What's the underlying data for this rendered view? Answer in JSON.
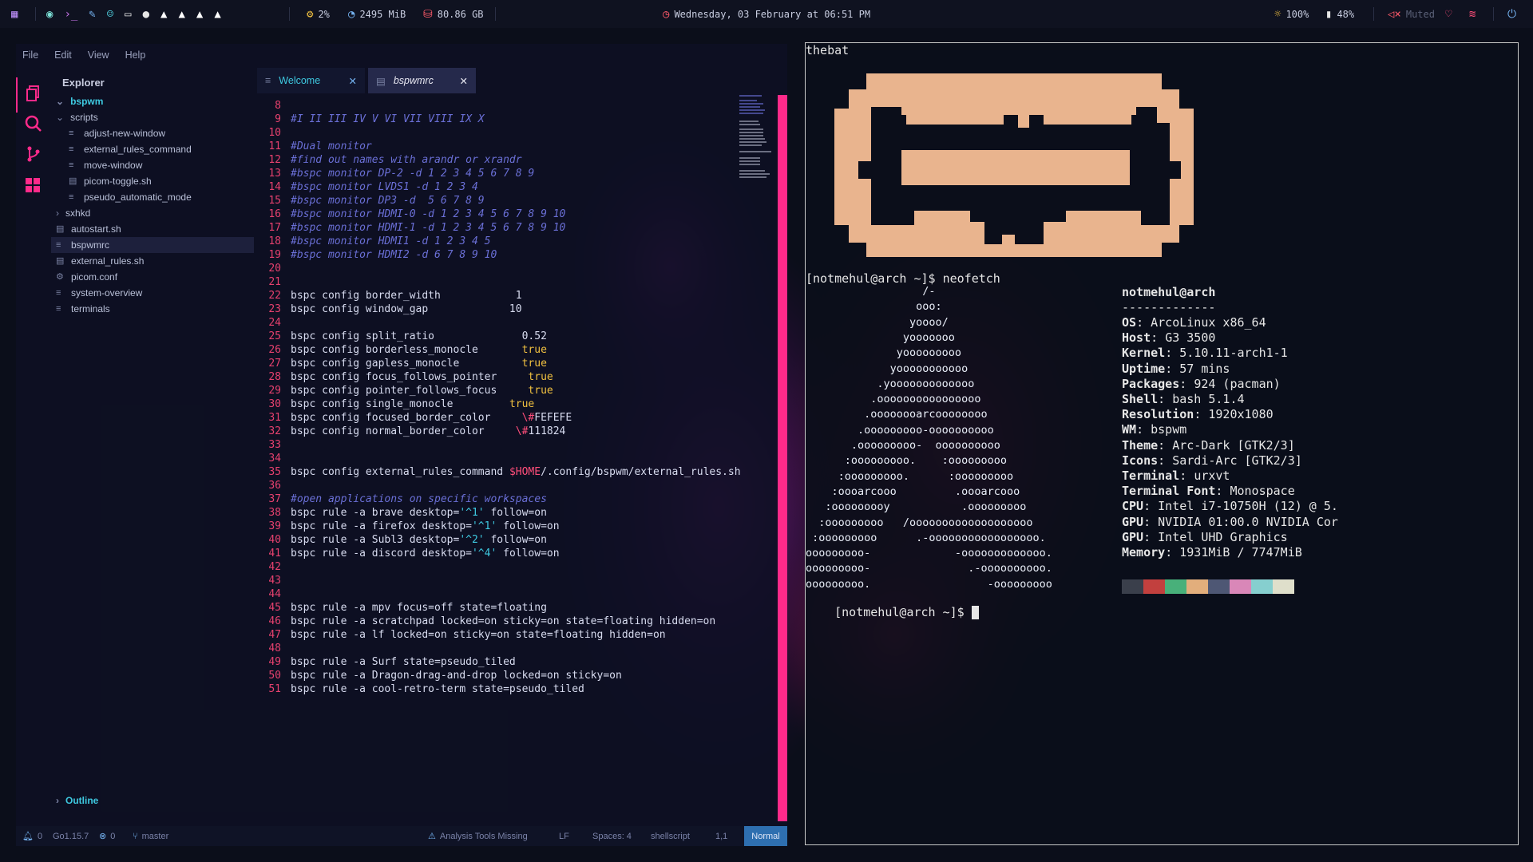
{
  "topbar": {
    "cpu": "2%",
    "memory": "2495 MiB",
    "disk": "80.86 GB",
    "datetime": "Wednesday, 03 February at 06:51 PM",
    "brightness": "100%",
    "battery": "48%",
    "volume": "Muted"
  },
  "editor": {
    "menu": [
      "File",
      "Edit",
      "View",
      "Help"
    ],
    "explorer_title": "Explorer",
    "root_folder": "bspwm",
    "tree": [
      {
        "label": "scripts",
        "type": "folder-open"
      },
      {
        "label": "adjust-new-window",
        "type": "file"
      },
      {
        "label": "external_rules_command",
        "type": "file"
      },
      {
        "label": "move-window",
        "type": "file"
      },
      {
        "label": "picom-toggle.sh",
        "type": "file"
      },
      {
        "label": "pseudo_automatic_mode",
        "type": "file"
      },
      {
        "label": "sxhkd",
        "type": "folder"
      },
      {
        "label": "autostart.sh",
        "type": "file"
      },
      {
        "label": "bspwmrc",
        "type": "file"
      },
      {
        "label": "external_rules.sh",
        "type": "file"
      },
      {
        "label": "picom.conf",
        "type": "settings"
      },
      {
        "label": "system-overview",
        "type": "file"
      },
      {
        "label": "terminals",
        "type": "file"
      }
    ],
    "outline_label": "Outline",
    "tabs": [
      {
        "label": "Welcome",
        "active": false
      },
      {
        "label": "bspwmrc",
        "active": true
      }
    ],
    "code_lines": [
      {
        "n": "8",
        "t": ""
      },
      {
        "n": "9",
        "t": "#I II III IV V VI VII VIII IX X"
      },
      {
        "n": "10",
        "t": ""
      },
      {
        "n": "11",
        "t": "#Dual monitor"
      },
      {
        "n": "12",
        "t": "#find out names with arandr or xrandr"
      },
      {
        "n": "13",
        "t": "#bspc monitor DP-2 -d 1 2 3 4 5 6 7 8 9"
      },
      {
        "n": "14",
        "t": "#bspc monitor LVDS1 -d 1 2 3 4"
      },
      {
        "n": "15",
        "t": "#bspc monitor DP3 -d  5 6 7 8 9"
      },
      {
        "n": "16",
        "t": "#bspc monitor HDMI-0 -d 1 2 3 4 5 6 7 8 9 10"
      },
      {
        "n": "17",
        "t": "#bspc monitor HDMI-1 -d 1 2 3 4 5 6 7 8 9 10"
      },
      {
        "n": "18",
        "t": "#bspc monitor HDMI1 -d 1 2 3 4 5"
      },
      {
        "n": "19",
        "t": "#bspc monitor HDMI2 -d 6 7 8 9 10"
      },
      {
        "n": "20",
        "t": ""
      },
      {
        "n": "21",
        "t": ""
      },
      {
        "n": "22",
        "t": "bspc config border_width            1"
      },
      {
        "n": "23",
        "t": "bspc config window_gap             10"
      },
      {
        "n": "24",
        "t": ""
      },
      {
        "n": "25",
        "t": "bspc config split_ratio              0.52"
      },
      {
        "n": "26",
        "t": "bspc config borderless_monocle       true"
      },
      {
        "n": "27",
        "t": "bspc config gapless_monocle          true"
      },
      {
        "n": "28",
        "t": "bspc config focus_follows_pointer     true"
      },
      {
        "n": "29",
        "t": "bspc config pointer_follows_focus     true"
      },
      {
        "n": "30",
        "t": "bspc config single_monocle         true"
      },
      {
        "n": "31",
        "t": "bspc config focused_border_color     \\#FEFEFE"
      },
      {
        "n": "32",
        "t": "bspc config normal_border_color     \\#111824"
      },
      {
        "n": "33",
        "t": ""
      },
      {
        "n": "34",
        "t": ""
      },
      {
        "n": "35",
        "t": "bspc config external_rules_command $HOME/.config/bspwm/external_rules.sh"
      },
      {
        "n": "36",
        "t": ""
      },
      {
        "n": "37",
        "t": "#open applications on specific workspaces"
      },
      {
        "n": "38",
        "t": "bspc rule -a brave desktop='^1' follow=on"
      },
      {
        "n": "39",
        "t": "bspc rule -a firefox desktop='^1' follow=on"
      },
      {
        "n": "40",
        "t": "bspc rule -a Subl3 desktop='^2' follow=on"
      },
      {
        "n": "41",
        "t": "bspc rule -a discord desktop='^4' follow=on"
      },
      {
        "n": "42",
        "t": ""
      },
      {
        "n": "43",
        "t": ""
      },
      {
        "n": "44",
        "t": ""
      },
      {
        "n": "45",
        "t": "bspc rule -a mpv focus=off state=floating"
      },
      {
        "n": "46",
        "t": "bspc rule -a scratchpad locked=on sticky=on state=floating hidden=on"
      },
      {
        "n": "47",
        "t": "bspc rule -a lf locked=on sticky=on state=floating hidden=on"
      },
      {
        "n": "48",
        "t": ""
      },
      {
        "n": "49",
        "t": "bspc rule -a Surf state=pseudo_tiled"
      },
      {
        "n": "50",
        "t": "bspc rule -a Dragon-drag-and-drop locked=on sticky=on"
      },
      {
        "n": "51",
        "t": "bspc rule -a cool-retro-term state=pseudo_tiled"
      }
    ],
    "status": {
      "notifications": "0",
      "go_version": "Go1.15.7",
      "errors": "0",
      "branch": "master",
      "analysis": "Analysis Tools Missing",
      "eol": "LF",
      "spaces": "Spaces: 4",
      "language": "shellscript",
      "position": "1,1",
      "mode": "Normal"
    }
  },
  "terminal": {
    "title": "thebat",
    "prompt1": "[notmehul@arch ~]$ neofetch",
    "prompt2": "[notmehul@arch ~]$ ",
    "user_host": "notmehul@arch",
    "dashes": "-------------",
    "info": [
      {
        "k": "OS",
        "v": "ArcoLinux x86_64"
      },
      {
        "k": "Host",
        "v": "G3 3500"
      },
      {
        "k": "Kernel",
        "v": "5.10.11-arch1-1"
      },
      {
        "k": "Uptime",
        "v": "57 mins"
      },
      {
        "k": "Packages",
        "v": "924 (pacman)"
      },
      {
        "k": "Shell",
        "v": "bash 5.1.4"
      },
      {
        "k": "Resolution",
        "v": "1920x1080"
      },
      {
        "k": "WM",
        "v": "bspwm"
      },
      {
        "k": "Theme",
        "v": "Arc-Dark [GTK2/3]"
      },
      {
        "k": "Icons",
        "v": "Sardi-Arc [GTK2/3]"
      },
      {
        "k": "Terminal",
        "v": "urxvt"
      },
      {
        "k": "Terminal Font",
        "v": "Monospace"
      },
      {
        "k": "CPU",
        "v": "Intel i7-10750H (12) @ 5."
      },
      {
        "k": "GPU",
        "v": "NVIDIA 01:00.0 NVIDIA Cor"
      },
      {
        "k": "GPU",
        "v": "Intel UHD Graphics"
      },
      {
        "k": "Memory",
        "v": "1931MiB / 7747MiB"
      }
    ],
    "logo": [
      "                  /-",
      "                 ooo:",
      "                yoooo/",
      "               yooooooo",
      "              yooooooooo",
      "             yooooooooooo",
      "           .yooooooooooooo",
      "          .oooooooooooooooo",
      "         .oooooooarcoooooooo",
      "        .ooooooooo-oooooooooo",
      "       .ooooooooo-  oooooooooo",
      "      :ooooooooo.    :ooooooooo",
      "     :ooooooooo.      :ooooooooo",
      "    :oooarcooo         .oooarcooo",
      "   :ooooooooy           .ooooooooo",
      "  :ooooooooo   /ooooooooooooooooooo",
      " :ooooooooo      .-ooooooooooooooooo.",
      "ooooooooo-             -ooooooooooooo.",
      "ooooooooo-               .-oooooooooo.",
      "ooooooooo.                  -ooooooooo"
    ],
    "palette": [
      "#3a3f4b",
      "#c2403e",
      "#48b07a",
      "#e2ae7c",
      "#4e5774",
      "#d987b8",
      "#86cfcf",
      "#dfdfcb"
    ]
  }
}
